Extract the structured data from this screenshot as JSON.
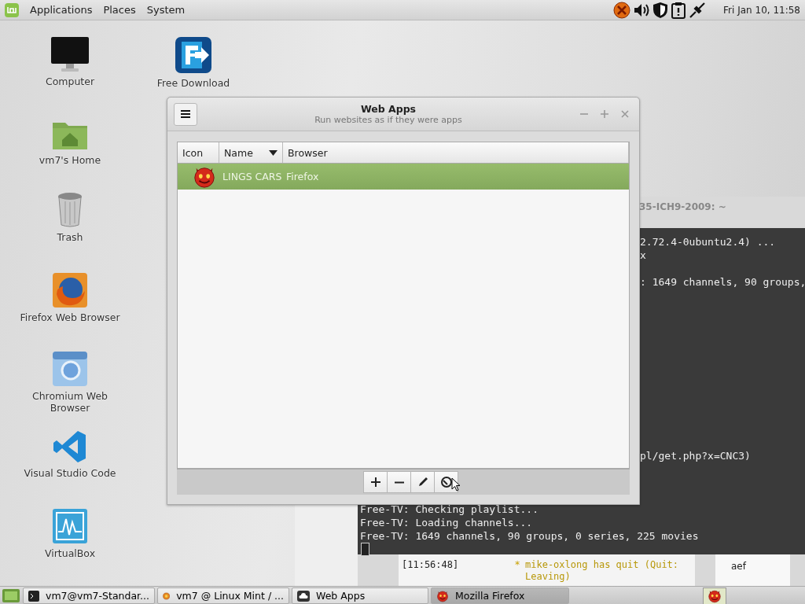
{
  "top_panel": {
    "menus": [
      "Applications",
      "Places",
      "System"
    ],
    "clock": "Fri Jan 10, 11:58"
  },
  "desktop_icons": [
    {
      "label": "Computer",
      "kind": "monitor"
    },
    {
      "label": "vm7's Home",
      "kind": "folder"
    },
    {
      "label": "Trash",
      "kind": "trash"
    },
    {
      "label": "Firefox Web Browser",
      "kind": "firefox"
    },
    {
      "label": "Chromium Web Browser",
      "kind": "chromium"
    },
    {
      "label": "Visual Studio Code",
      "kind": "vscode"
    },
    {
      "label": "VirtualBox",
      "kind": "virtualbox"
    },
    {
      "label": "Free Download",
      "kind": "download"
    }
  ],
  "terminal": {
    "title": "35-ICH9-2009: ~",
    "upper_lines": [
      "2.72.4-0ubuntu2.4) ...",
      "x",
      ": 1649 channels, 90 groups,",
      "pl/get.php?x=CNC3)"
    ],
    "lower_lines": [
      "Free-TV: Checking playlist...",
      "Free-TV: Loading channels...",
      "Free-TV: 1649 channels, 90 groups, 0 series, 225 movies"
    ]
  },
  "chat": {
    "time": "[11:56:48]",
    "marker": "*",
    "message": "mike-oxlong has quit (Quit: Leaving)",
    "user": "aef"
  },
  "web_apps": {
    "title": "Web Apps",
    "subtitle": "Run websites as if they were apps",
    "columns": [
      {
        "label": "Icon",
        "sorted": false
      },
      {
        "label": "Name",
        "sorted": true
      },
      {
        "label": "Browser",
        "sorted": false
      }
    ],
    "rows": [
      {
        "name": "LINGS CARS",
        "browser": "Firefox",
        "selected": true
      }
    ],
    "toolbar": [
      {
        "kind": "add"
      },
      {
        "kind": "remove"
      },
      {
        "kind": "edit"
      },
      {
        "kind": "launch"
      }
    ]
  },
  "taskbar": [
    {
      "label": "vm7@vm7-Standar...",
      "kind": "terminal",
      "selected": false
    },
    {
      "label": "vm7 @ Linux Mint / ...",
      "kind": "mint",
      "selected": false
    },
    {
      "label": "Web Apps",
      "kind": "webapps",
      "selected": false
    },
    {
      "label": "Mozilla Firefox",
      "kind": "devil",
      "selected": true
    }
  ]
}
